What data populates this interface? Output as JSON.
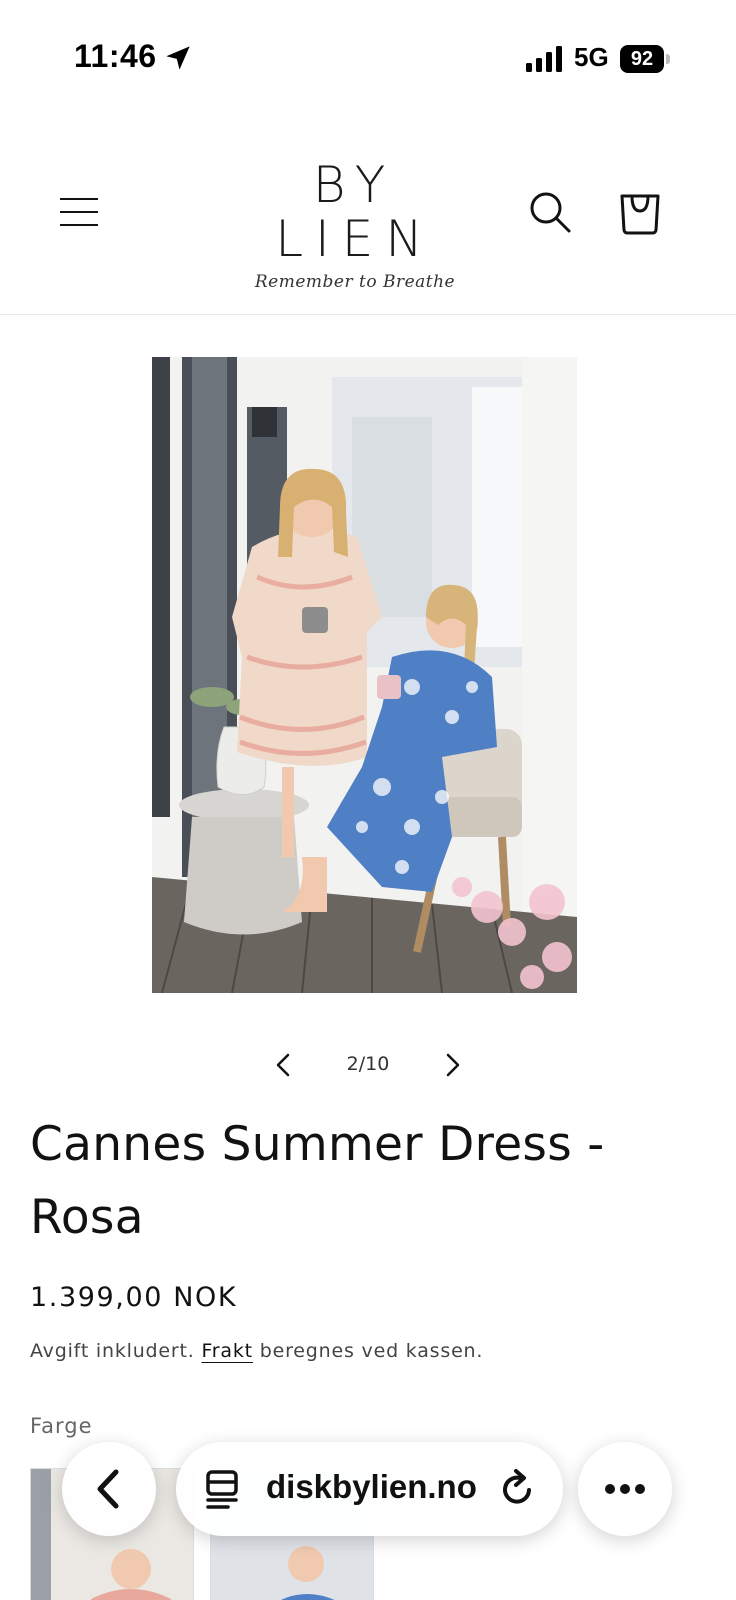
{
  "status_bar": {
    "time": "11:46",
    "network": "5G",
    "battery": "92"
  },
  "header": {
    "logo_text": "BY LIEN",
    "tagline": "Remember to Breathe"
  },
  "gallery": {
    "counter": "2/10"
  },
  "product": {
    "title": "Cannes Summer Dress - Rosa",
    "price": "1.399,00 NOK",
    "tax_prefix": "Avgift inkludert.",
    "shipping_link": "Frakt",
    "tax_suffix": "beregnes ved kassen.",
    "color_label": "Farge"
  },
  "browser": {
    "url": "diskbylien.no"
  },
  "colors": {
    "text": "#121212",
    "dress_pink": "#e8a99c",
    "dress_blue": "#4f7fc4"
  }
}
